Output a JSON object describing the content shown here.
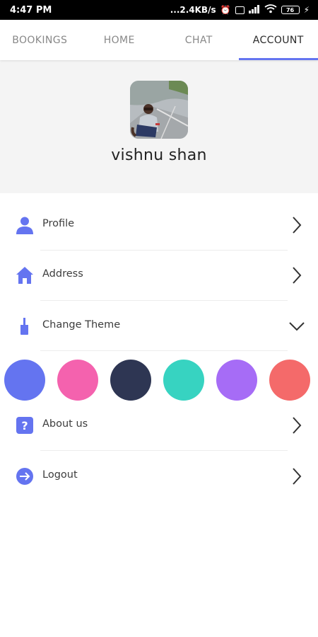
{
  "status_bar": {
    "time": "4:47 PM",
    "network_speed": "...2.4KB/s",
    "battery_level": "76"
  },
  "tabs": [
    {
      "label": "BOOKINGS",
      "active": false
    },
    {
      "label": "HOME",
      "active": false
    },
    {
      "label": "CHAT",
      "active": false
    },
    {
      "label": "ACCOUNT",
      "active": true
    }
  ],
  "profile": {
    "name": "vishnu shan"
  },
  "menu": {
    "profile": {
      "label": "Profile",
      "icon": "person-icon"
    },
    "address": {
      "label": "Address",
      "icon": "home-icon"
    },
    "theme": {
      "label": "Change Theme",
      "icon": "paint-brush-icon",
      "expanded": true
    },
    "about": {
      "label": "About us",
      "icon": "help-icon"
    },
    "logout": {
      "label": "Logout",
      "icon": "logout-icon"
    }
  },
  "theme_colors": [
    "#6474f0",
    "#f462ae",
    "#2e3653",
    "#37d3c1",
    "#a66cf6",
    "#f46a6a"
  ],
  "accent": "#6474f0"
}
